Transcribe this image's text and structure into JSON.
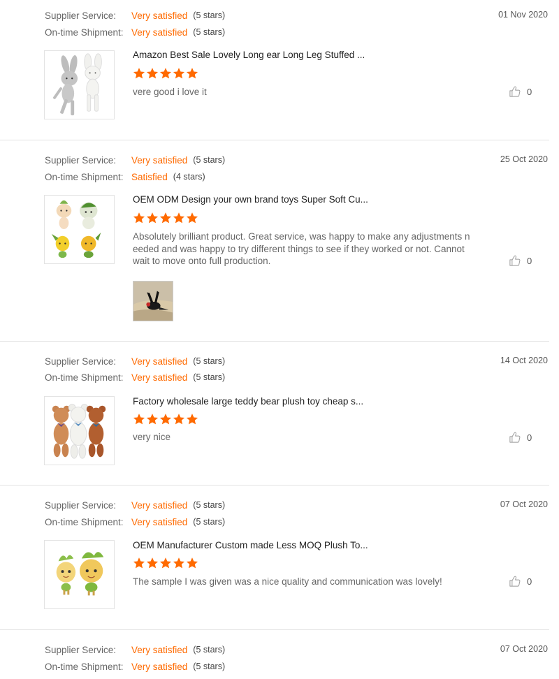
{
  "labels": {
    "supplier_service": "Supplier Service:",
    "ontime_shipment": "On-time Shipment:"
  },
  "colors": {
    "accent": "#ff6a00",
    "divider": "#e3e3e3",
    "text_muted": "#666666"
  },
  "reviews": [
    {
      "supplier_rating": "Very satisfied",
      "supplier_stars": "(5 stars)",
      "shipment_rating": "Very satisfied",
      "shipment_stars": "(5 stars)",
      "date": "01 Nov 2020",
      "product_title": "Amazon Best Sale Lovely Long ear Long Leg Stuffed ...",
      "product_image": "grey-and-white-bunny-plush-toys",
      "star_rating": 5,
      "review_text": "vere good i love it",
      "likes": "0"
    },
    {
      "supplier_rating": "Very satisfied",
      "supplier_stars": "(5 stars)",
      "shipment_rating": "Satisfied",
      "shipment_stars": "(4 stars)",
      "date": "25 Oct 2020",
      "product_title": "OEM ODM Design your own brand toys Super Soft Cu...",
      "product_image": "custom-vegetable-mascot-plush-toys",
      "star_rating": 5,
      "review_text": "Absolutely brilliant product. Great service, was happy to make any adjustments needed and was happy to try different things to see if they worked or not. Cannot wait to move onto full production.",
      "review_photo": "black-bird-plush-on-sand-photo",
      "likes": "0"
    },
    {
      "supplier_rating": "Very satisfied",
      "supplier_stars": "(5 stars)",
      "shipment_rating": "Very satisfied",
      "shipment_stars": "(5 stars)",
      "date": "14 Oct 2020",
      "product_title": "Factory wholesale large teddy bear plush toy cheap s...",
      "product_image": "three-teddy-bears-plush",
      "star_rating": 5,
      "review_text": "very nice",
      "likes": "0"
    },
    {
      "supplier_rating": "Very satisfied",
      "supplier_stars": "(5 stars)",
      "shipment_rating": "Very satisfied",
      "shipment_stars": "(5 stars)",
      "date": "07 Oct 2020",
      "product_title": "OEM Manufacturer Custom made Less MOQ Plush To...",
      "product_image": "two-fruit-mascot-plush-toys",
      "star_rating": 5,
      "review_text": "The sample I was given was a nice quality and communication was lovely!",
      "likes": "0"
    },
    {
      "supplier_rating": "Very satisfied",
      "supplier_stars": "(5 stars)",
      "shipment_rating": "Very satisfied",
      "shipment_stars": "(5 stars)",
      "date": "07 Oct 2020"
    }
  ]
}
